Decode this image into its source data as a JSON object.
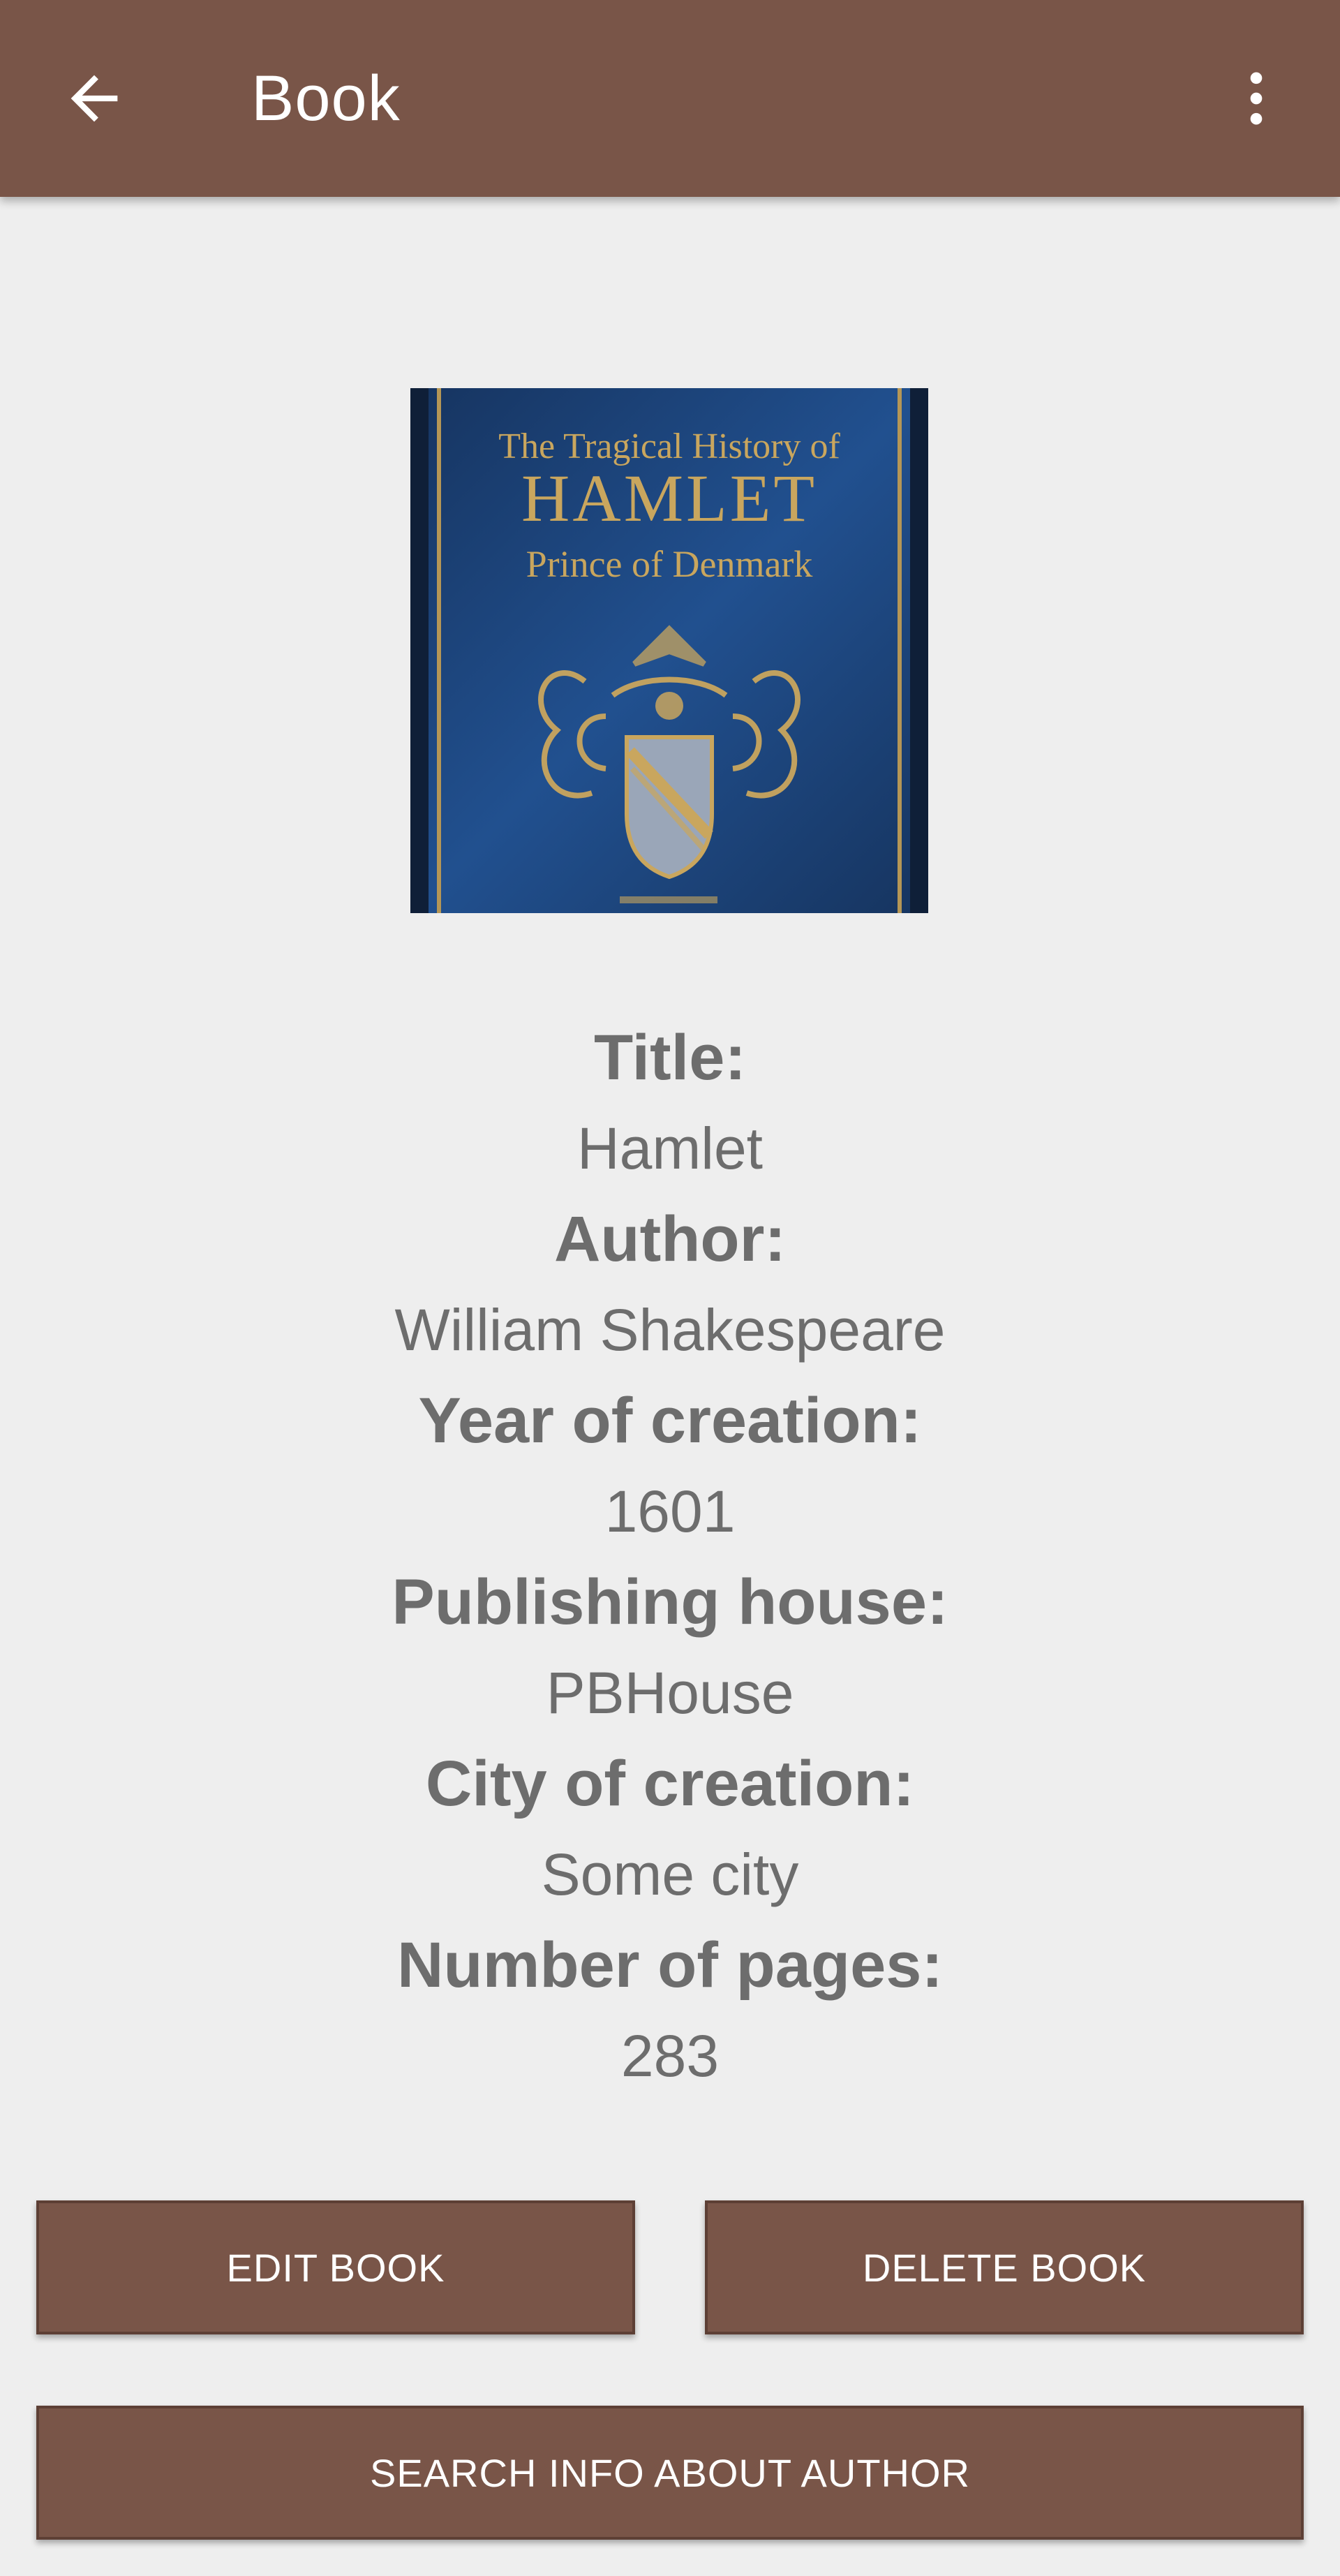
{
  "appbar": {
    "title": "Book",
    "back_icon": "arrow-back-icon",
    "overflow_icon": "more-vert-icon",
    "color": "#795548"
  },
  "cover": {
    "line1": "The Tragical History of",
    "line2": "HAMLET",
    "line3": "Prince of Denmark",
    "background_color": "#1b3f78",
    "text_color": "#c9a65e"
  },
  "details": [
    {
      "label": "Title:",
      "value": "Hamlet"
    },
    {
      "label": "Author:",
      "value": "William Shakespeare"
    },
    {
      "label": "Year of creation:",
      "value": "1601"
    },
    {
      "label": "Publishing house:",
      "value": "PBHouse"
    },
    {
      "label": "City of creation:",
      "value": "Some city"
    },
    {
      "label": "Number of pages:",
      "value": "283"
    }
  ],
  "buttons": {
    "edit": "EDIT BOOK",
    "delete": "DELETE BOOK",
    "search": "SEARCH INFO ABOUT AUTHOR"
  }
}
